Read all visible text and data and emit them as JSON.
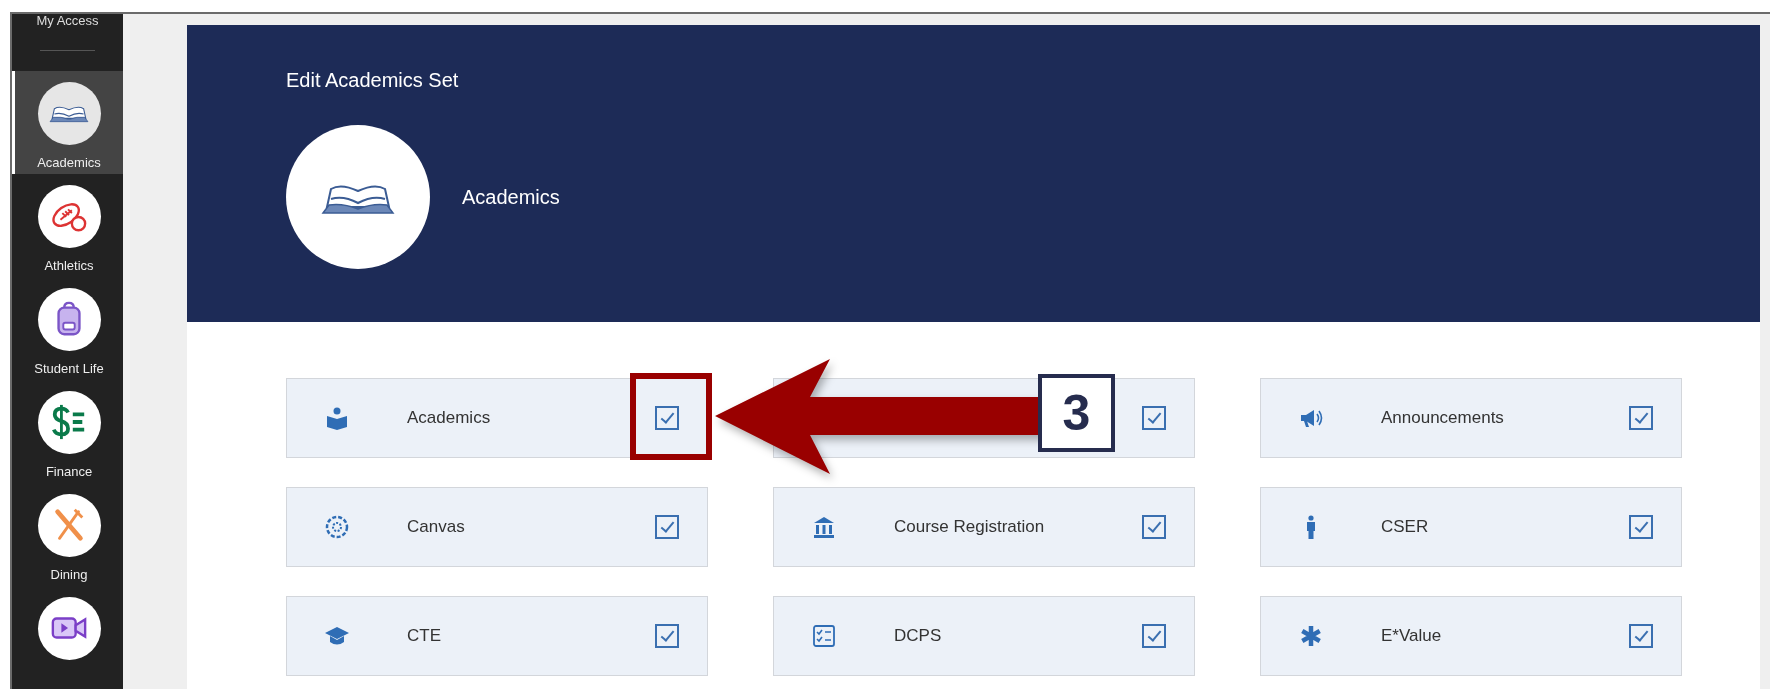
{
  "sidebar": {
    "top_label": "My Access",
    "items": [
      {
        "label": "Academics",
        "selected": true
      },
      {
        "label": "Athletics",
        "selected": false
      },
      {
        "label": "Student Life",
        "selected": false
      },
      {
        "label": "Finance",
        "selected": false
      },
      {
        "label": "Dining",
        "selected": false
      },
      {
        "selected": false
      }
    ]
  },
  "header": {
    "title": "Edit Academics Set",
    "set_name": "Academics"
  },
  "items": [
    {
      "label": "Academics",
      "checked": true
    },
    {
      "checked": true
    },
    {
      "label": "Announcements",
      "checked": true
    },
    {
      "label": "Canvas",
      "checked": true
    },
    {
      "label": "Course Registration",
      "checked": true
    },
    {
      "label": "CSER",
      "checked": true
    },
    {
      "label": "CTE",
      "checked": true
    },
    {
      "label": "DCPS",
      "checked": true
    },
    {
      "label": "E*Value",
      "checked": true
    }
  ],
  "annotation": {
    "step": "3"
  }
}
